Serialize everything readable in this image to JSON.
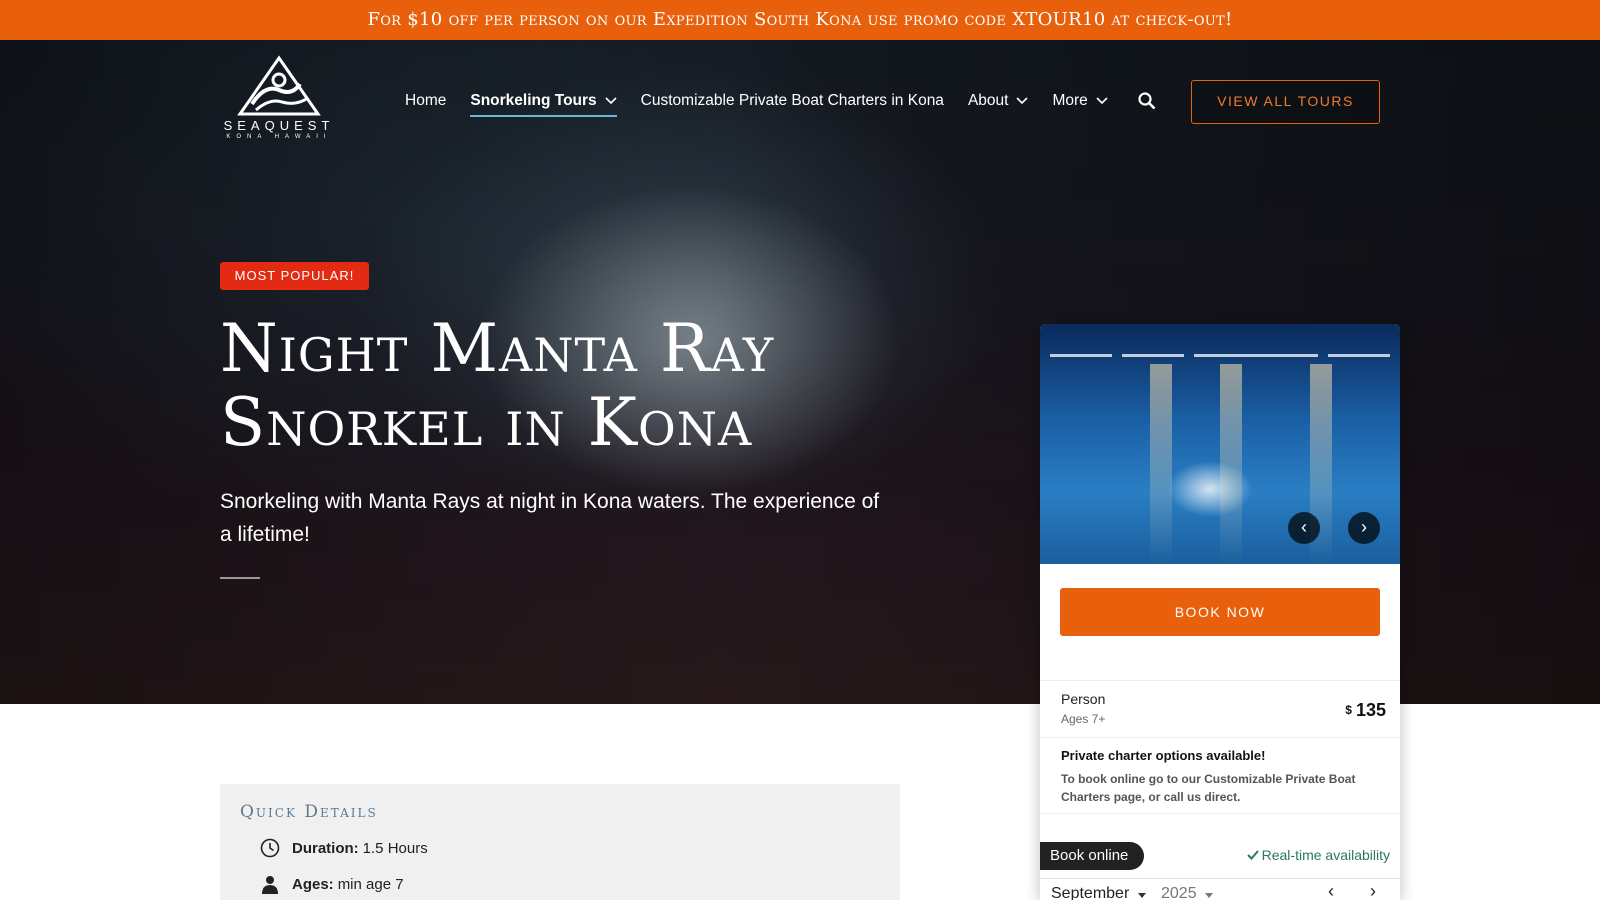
{
  "promo": {
    "text": "For $10 off per person on our Expedition South Kona use promo code XTOUR10 at check-out!"
  },
  "logo": {
    "name": "SEAQUEST",
    "subtitle": "KONA HAWAII"
  },
  "nav": {
    "items": [
      {
        "label": "Home",
        "dropdown": false
      },
      {
        "label": "Snorkeling Tours",
        "dropdown": true,
        "active": true
      },
      {
        "label": "Customizable Private Boat Charters in Kona",
        "dropdown": false
      },
      {
        "label": "About",
        "dropdown": true
      },
      {
        "label": "More",
        "dropdown": true
      }
    ],
    "search_icon": "search-icon",
    "cta_label": "VIEW ALL TOURS"
  },
  "hero": {
    "badge": "MOST POPULAR!",
    "title_line1": "Night Manta Ray",
    "title_line2": "Snorkel in Kona",
    "subtitle": "Snorkeling with Manta Rays at night in Kona waters. The experience of a lifetime!"
  },
  "booking": {
    "carousel_prev": "‹",
    "carousel_next": "›",
    "book_now": "BOOK NOW",
    "price": {
      "label": "Person",
      "sublabel": "Ages 7+",
      "currency": "$",
      "amount": "135"
    },
    "charter": {
      "title": "Private charter options available!",
      "text": "To book online go to our Customizable Private Boat Charters page, or call us direct."
    },
    "book_online": "Book online",
    "realtime": "Real-time availability",
    "calendar": {
      "month": "September",
      "year": "2025",
      "prev": "‹",
      "next": "›"
    }
  },
  "quick_details": {
    "title": "Quick Details",
    "duration_key": "Duration:",
    "duration_value": "1.5 Hours",
    "ages_key": "Ages:",
    "ages_value": "min age 7"
  },
  "colors": {
    "accent": "#e8600c",
    "badge": "#e22b12",
    "nav_underline": "#6bb7d8",
    "realtime_green": "#2a7a57"
  }
}
